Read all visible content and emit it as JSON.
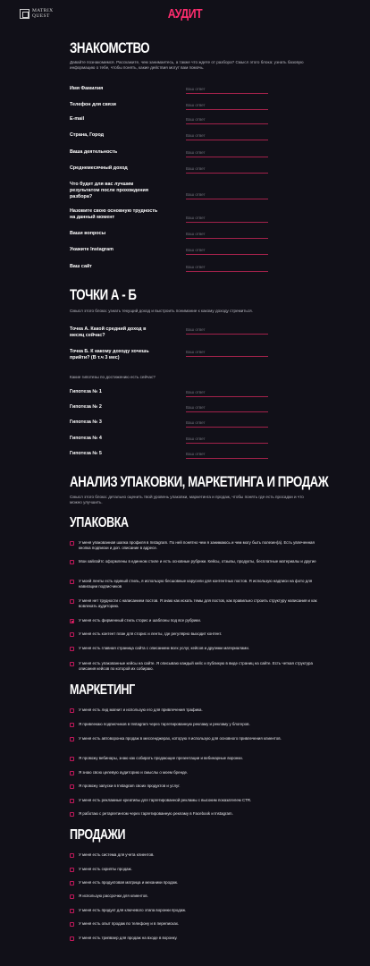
{
  "header": {
    "logo_line1": "MATRIX",
    "logo_line2": "QUEST",
    "title": "АУДИТ"
  },
  "intro": {
    "title": "ЗНАКОМСТВО",
    "desc": "Давайте познакомимся. Расскажите, чем занимаетесь, а также что ждете от разбора? Смысл этого блока: узнать базовую информацию о тебе, чтобы понять, какие действия могут вам помочь.",
    "placeholder": "Ваш ответ",
    "fields": [
      "Имя Фамилия",
      "Телефон для связи",
      "E-mail",
      "Страна, Город",
      "Ваша деятельность",
      "Среднемесячный доход",
      "Что будет для вас лучшим результатом после прохождения разбора?",
      "Назовите свою основную трудность на данный момент",
      "Ваши вопросы",
      "Укажите Instagram",
      "Ваш сайт"
    ]
  },
  "ab": {
    "title": "ТОЧКИ А - Б",
    "desc": "Смысл этого блока: узнать текущий доход и выстроить понимание к какому доходу стремиться.",
    "fields": [
      "Точка А. Какой средний доход в месяц сейчас?",
      "Точка Б. К какому доходу хочешь прийти? (В т.ч 3 мес)"
    ],
    "hyp_caption": "Какие гипотезы по достижению есть сейчас?",
    "hypotheses": [
      "Гипотеза № 1",
      "Гипотеза № 2",
      "Гипотеза № 3",
      "Гипотеза № 4",
      "Гипотеза № 5"
    ]
  },
  "analysis": {
    "title": "АНАЛИЗ УПАКОВКИ, МАРКЕТИНГА И ПРОДАЖ",
    "desc": "Смысл этого блока: детально оценить твой уровень упаковки, маркетинга и продаж, чтобы понять где есть просадки и что можно улучшить."
  },
  "packaging": {
    "title": "УПАКОВКА",
    "items": [
      {
        "text": "У меня упакованная шапка профиля в Instagram. По ней понятно чем я занимаюсь и чем могу быть полезен(а). Есть увлеченная кнопка подписки и доп. описание в адресе.",
        "checked": false
      },
      {
        "text": "Мои хайлайтс оформлены в единном стиле и есть основные рубрики. Кейсы, отзывы, продукты, бесплатные материалы и другие",
        "checked": false
      },
      {
        "text": "У моей ленты есть единый стиль, я использую бесшовные карусели для контентных постов. Я использую надписи на фото для навигации подписчиков",
        "checked": false
      },
      {
        "text": "У меня нет трудности с написанием постов. Я знаю как искать темы для постов, как правильно строить структуру написания и как вовлекать аудиторию.",
        "checked": false
      },
      {
        "text": "У меня есть фирменный стиль сторис и шаблоны под все рубрики.",
        "checked": true
      },
      {
        "text": "У меня есть контент план для сторис и ленты, где регулярно выходит контент.",
        "checked": false
      },
      {
        "text": "У меня есть главная страница сайта с описанием всех услуг, кейсов и другими материалами.",
        "checked": false
      },
      {
        "text": "У меня есть упакованные кейсы на сайте. Я описываю каждый кейс и публикую в виде страниц на сайте. Есть четкая структура описания кейсов по которой их собираю.",
        "checked": false
      }
    ]
  },
  "marketing": {
    "title": "МАРКЕТИНГ",
    "items": [
      {
        "text": "У меня есть лид магнит и использую его для привлечения трафика.",
        "checked": false
      },
      {
        "text": "Я привлекаю подписчиков в Instagram через таргетированную рекламу и рекламу у блогеров.",
        "checked": false
      },
      {
        "text": "У меня есть автоворонка продаж в мессенджерах, которую я использую для основного привлечения клиентов.",
        "checked": false
      },
      {
        "text": "Я провожу вебинары, знаю как собирать продающие презентации и вебинарные воронки.",
        "checked": false
      },
      {
        "text": "Я знаю свою целевую аудиторию и смыслы о моем бренде.",
        "checked": false
      },
      {
        "text": "Я провожу запуски в Instagram своих продуктов и услуг.",
        "checked": false
      },
      {
        "text": "У меня есть рекламные креативы для таргетированной рекламы с высоким показателем CTR.",
        "checked": false
      },
      {
        "text": "Я работаю с ретаргетингом через таргетированную рекламу в Facebook и Instagram.",
        "checked": false
      }
    ]
  },
  "sales": {
    "title": "ПРОДАЖИ",
    "items": [
      {
        "text": "У меня есть система для учета клиентов.",
        "checked": false
      },
      {
        "text": "У меня есть скрипты продаж.",
        "checked": false
      },
      {
        "text": "У меня есть продуктовая матрица и механики продаж.",
        "checked": false
      },
      {
        "text": "Я использую рассрочки для клиентов.",
        "checked": false
      },
      {
        "text": "У меня есть продукт для ключевого этапа воронки продаж.",
        "checked": false
      },
      {
        "text": "У меня есть опыт продаж по телефону и в переписках.",
        "checked": false
      },
      {
        "text": "У меня есть трипваер для продаж на входе в воронку.",
        "checked": false
      }
    ]
  }
}
